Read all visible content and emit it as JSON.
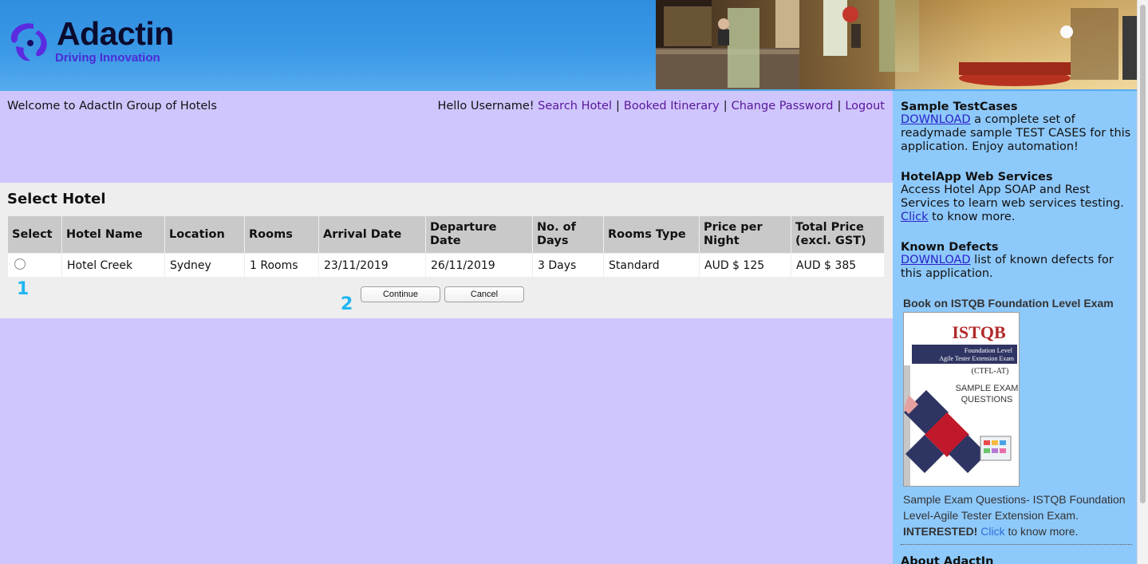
{
  "brand": {
    "name": "Adactin",
    "tagline": "Driving Innovation"
  },
  "welcome_text": "Welcome to AdactIn Group of Hotels",
  "nav": {
    "greeting": "Hello Username!",
    "links": [
      "Search Hotel",
      "Booked Itinerary",
      "Change Password",
      "Logout"
    ],
    "separator": "|"
  },
  "select_hotel": {
    "title": "Select Hotel",
    "headers": [
      "Select",
      "Hotel Name",
      "Location",
      "Rooms",
      "Arrival Date",
      "Departure Date",
      "No. of Days",
      "Rooms Type",
      "Price per Night",
      "Total Price (excl. GST)"
    ],
    "rows": [
      {
        "hotel_name": "Hotel Creek",
        "location": "Sydney",
        "rooms": "1 Rooms",
        "arrival_date": "23/11/2019",
        "departure_date": "26/11/2019",
        "days": "3 Days",
        "room_type": "Standard",
        "price_per_night": "AUD $ 125",
        "total_price": "AUD $ 385"
      }
    ],
    "continue_label": "Continue",
    "cancel_label": "Cancel",
    "markers": [
      "1",
      "2"
    ]
  },
  "sidebar": {
    "testcases": {
      "title": "Sample TestCases",
      "link": "DOWNLOAD",
      "text": " a complete set of readymade sample TEST CASES for this application. Enjoy automation!"
    },
    "webservices": {
      "title": "HotelApp Web Services",
      "text": "Access Hotel App SOAP and Rest Services to learn web services testing.",
      "link": "Click",
      "text_after": " to know more."
    },
    "defects": {
      "title": "Known Defects",
      "link": "DOWNLOAD",
      "text": " list of known defects for this application."
    },
    "book": {
      "title": "Book on ISTQB Foundation Level Exam",
      "cover": {
        "brand": "ISTQB",
        "line1": "Foundation Level",
        "line2": "Agile Tester Extension Exam",
        "code": "(CTFL-AT)",
        "sample1": "SAMPLE EXAM",
        "sample2": "QUESTIONS"
      },
      "caption": "Sample Exam Questions- ISTQB Foundation Level-Agile Tester Extension Exam.",
      "interested": "INTERESTED!",
      "link": "Click",
      "caption_after": " to know more."
    },
    "about_title": "About AdactIn"
  },
  "colors": {
    "page_bg": "#cfc6fd",
    "sidebar_bg": "#8ec9fb",
    "header_blue": "#3a98e6",
    "nav_link": "#5a169a",
    "marker": "#1fb6f1"
  }
}
